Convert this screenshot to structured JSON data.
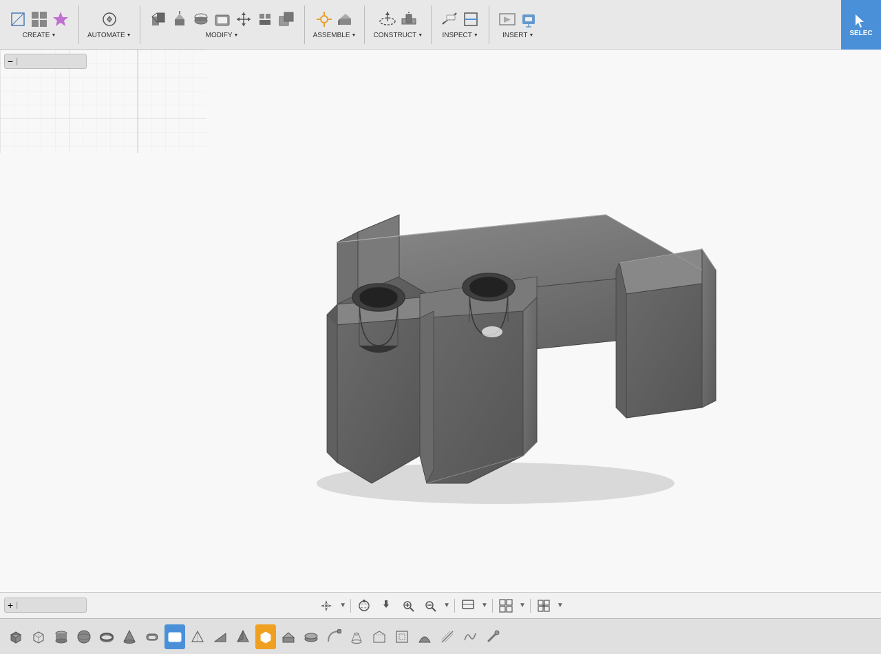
{
  "toolbar": {
    "groups": [
      {
        "id": "create",
        "label": "CREATE",
        "icons": [
          "✦",
          "⊞",
          "◈",
          "✧"
        ],
        "hasArrow": true,
        "active": false
      },
      {
        "id": "automate",
        "label": "AUTOMATE",
        "icons": [
          "⚙",
          "◈"
        ],
        "hasArrow": true,
        "active": false
      },
      {
        "id": "modify",
        "label": "MODIFY",
        "icons": [
          "⊡",
          "◫",
          "⊓",
          "⊔",
          "⊕",
          "✛",
          "⊞"
        ],
        "hasArrow": true,
        "active": false
      },
      {
        "id": "assemble",
        "label": "ASSEMBLE",
        "icons": [
          "✦",
          "◈"
        ],
        "hasArrow": true,
        "active": false
      },
      {
        "id": "construct",
        "label": "CONSTRUCT",
        "icons": [
          "◈",
          "⊠"
        ],
        "hasArrow": true,
        "active": false
      },
      {
        "id": "inspect",
        "label": "INSPECT",
        "icons": [
          "⊟",
          "⊠"
        ],
        "hasArrow": true,
        "active": false
      },
      {
        "id": "insert",
        "label": "INSERT",
        "icons": [
          "⊞",
          "⊡"
        ],
        "hasArrow": true,
        "active": false
      }
    ],
    "select_label": "SELEC",
    "minimize_label": "−  |"
  },
  "viewport": {
    "background": "#f8f8f8",
    "grid_color": "#e0e0e0"
  },
  "bottom_view_tools": [
    {
      "id": "navigate",
      "icon": "✛",
      "label": "navigate"
    },
    {
      "id": "orbit",
      "icon": "⊙",
      "label": "orbit"
    },
    {
      "id": "pan",
      "icon": "✋",
      "label": "pan"
    },
    {
      "id": "zoom-fit",
      "icon": "⊞",
      "label": "zoom-fit"
    },
    {
      "id": "zoom",
      "icon": "🔍",
      "label": "zoom"
    },
    {
      "id": "display",
      "icon": "▣",
      "label": "display"
    },
    {
      "id": "grid-toggle",
      "icon": "⊞",
      "label": "grid-toggle"
    },
    {
      "id": "snap",
      "icon": "⊟",
      "label": "snap"
    }
  ],
  "shapes_toolbar": [
    {
      "id": "s1",
      "icon": "⬛",
      "active": false
    },
    {
      "id": "s2",
      "icon": "◻",
      "active": false
    },
    {
      "id": "s3",
      "icon": "⬡",
      "active": false
    },
    {
      "id": "s4",
      "icon": "◯",
      "active": false
    },
    {
      "id": "s5",
      "icon": "⬠",
      "active": false
    },
    {
      "id": "s6",
      "icon": "⬢",
      "active": false
    },
    {
      "id": "s7",
      "icon": "▣",
      "active": false
    },
    {
      "id": "s8",
      "icon": "⬤",
      "active": true
    },
    {
      "id": "s9",
      "icon": "◪",
      "active": false
    },
    {
      "id": "s10",
      "icon": "◫",
      "active": false
    },
    {
      "id": "s11",
      "icon": "⊡",
      "active": false
    },
    {
      "id": "s12",
      "icon": "⊞",
      "active": true,
      "special": "orange"
    },
    {
      "id": "s13",
      "icon": "⬕",
      "active": false
    },
    {
      "id": "s14",
      "icon": "◬",
      "active": false
    },
    {
      "id": "s15",
      "icon": "⬖",
      "active": false
    },
    {
      "id": "s16",
      "icon": "⬗",
      "active": false
    },
    {
      "id": "s17",
      "icon": "⬘",
      "active": false
    },
    {
      "id": "s18",
      "icon": "◭",
      "active": false
    },
    {
      "id": "s19",
      "icon": "◮",
      "active": false
    },
    {
      "id": "s20",
      "icon": "⬙",
      "active": false
    },
    {
      "id": "s21",
      "icon": "⬚",
      "active": false
    },
    {
      "id": "s22",
      "icon": "⬛",
      "active": false
    },
    {
      "id": "s23",
      "icon": "⬜",
      "active": false
    },
    {
      "id": "s24",
      "icon": "▦",
      "active": false
    },
    {
      "id": "s25",
      "icon": "▧",
      "active": false
    },
    {
      "id": "s26",
      "icon": "⊕",
      "active": false
    },
    {
      "id": "bottom-plus",
      "icon": "+",
      "active": false
    }
  ],
  "model": {
    "description": "3D mechanical part - T-shaped bracket with cylindrical holes"
  }
}
